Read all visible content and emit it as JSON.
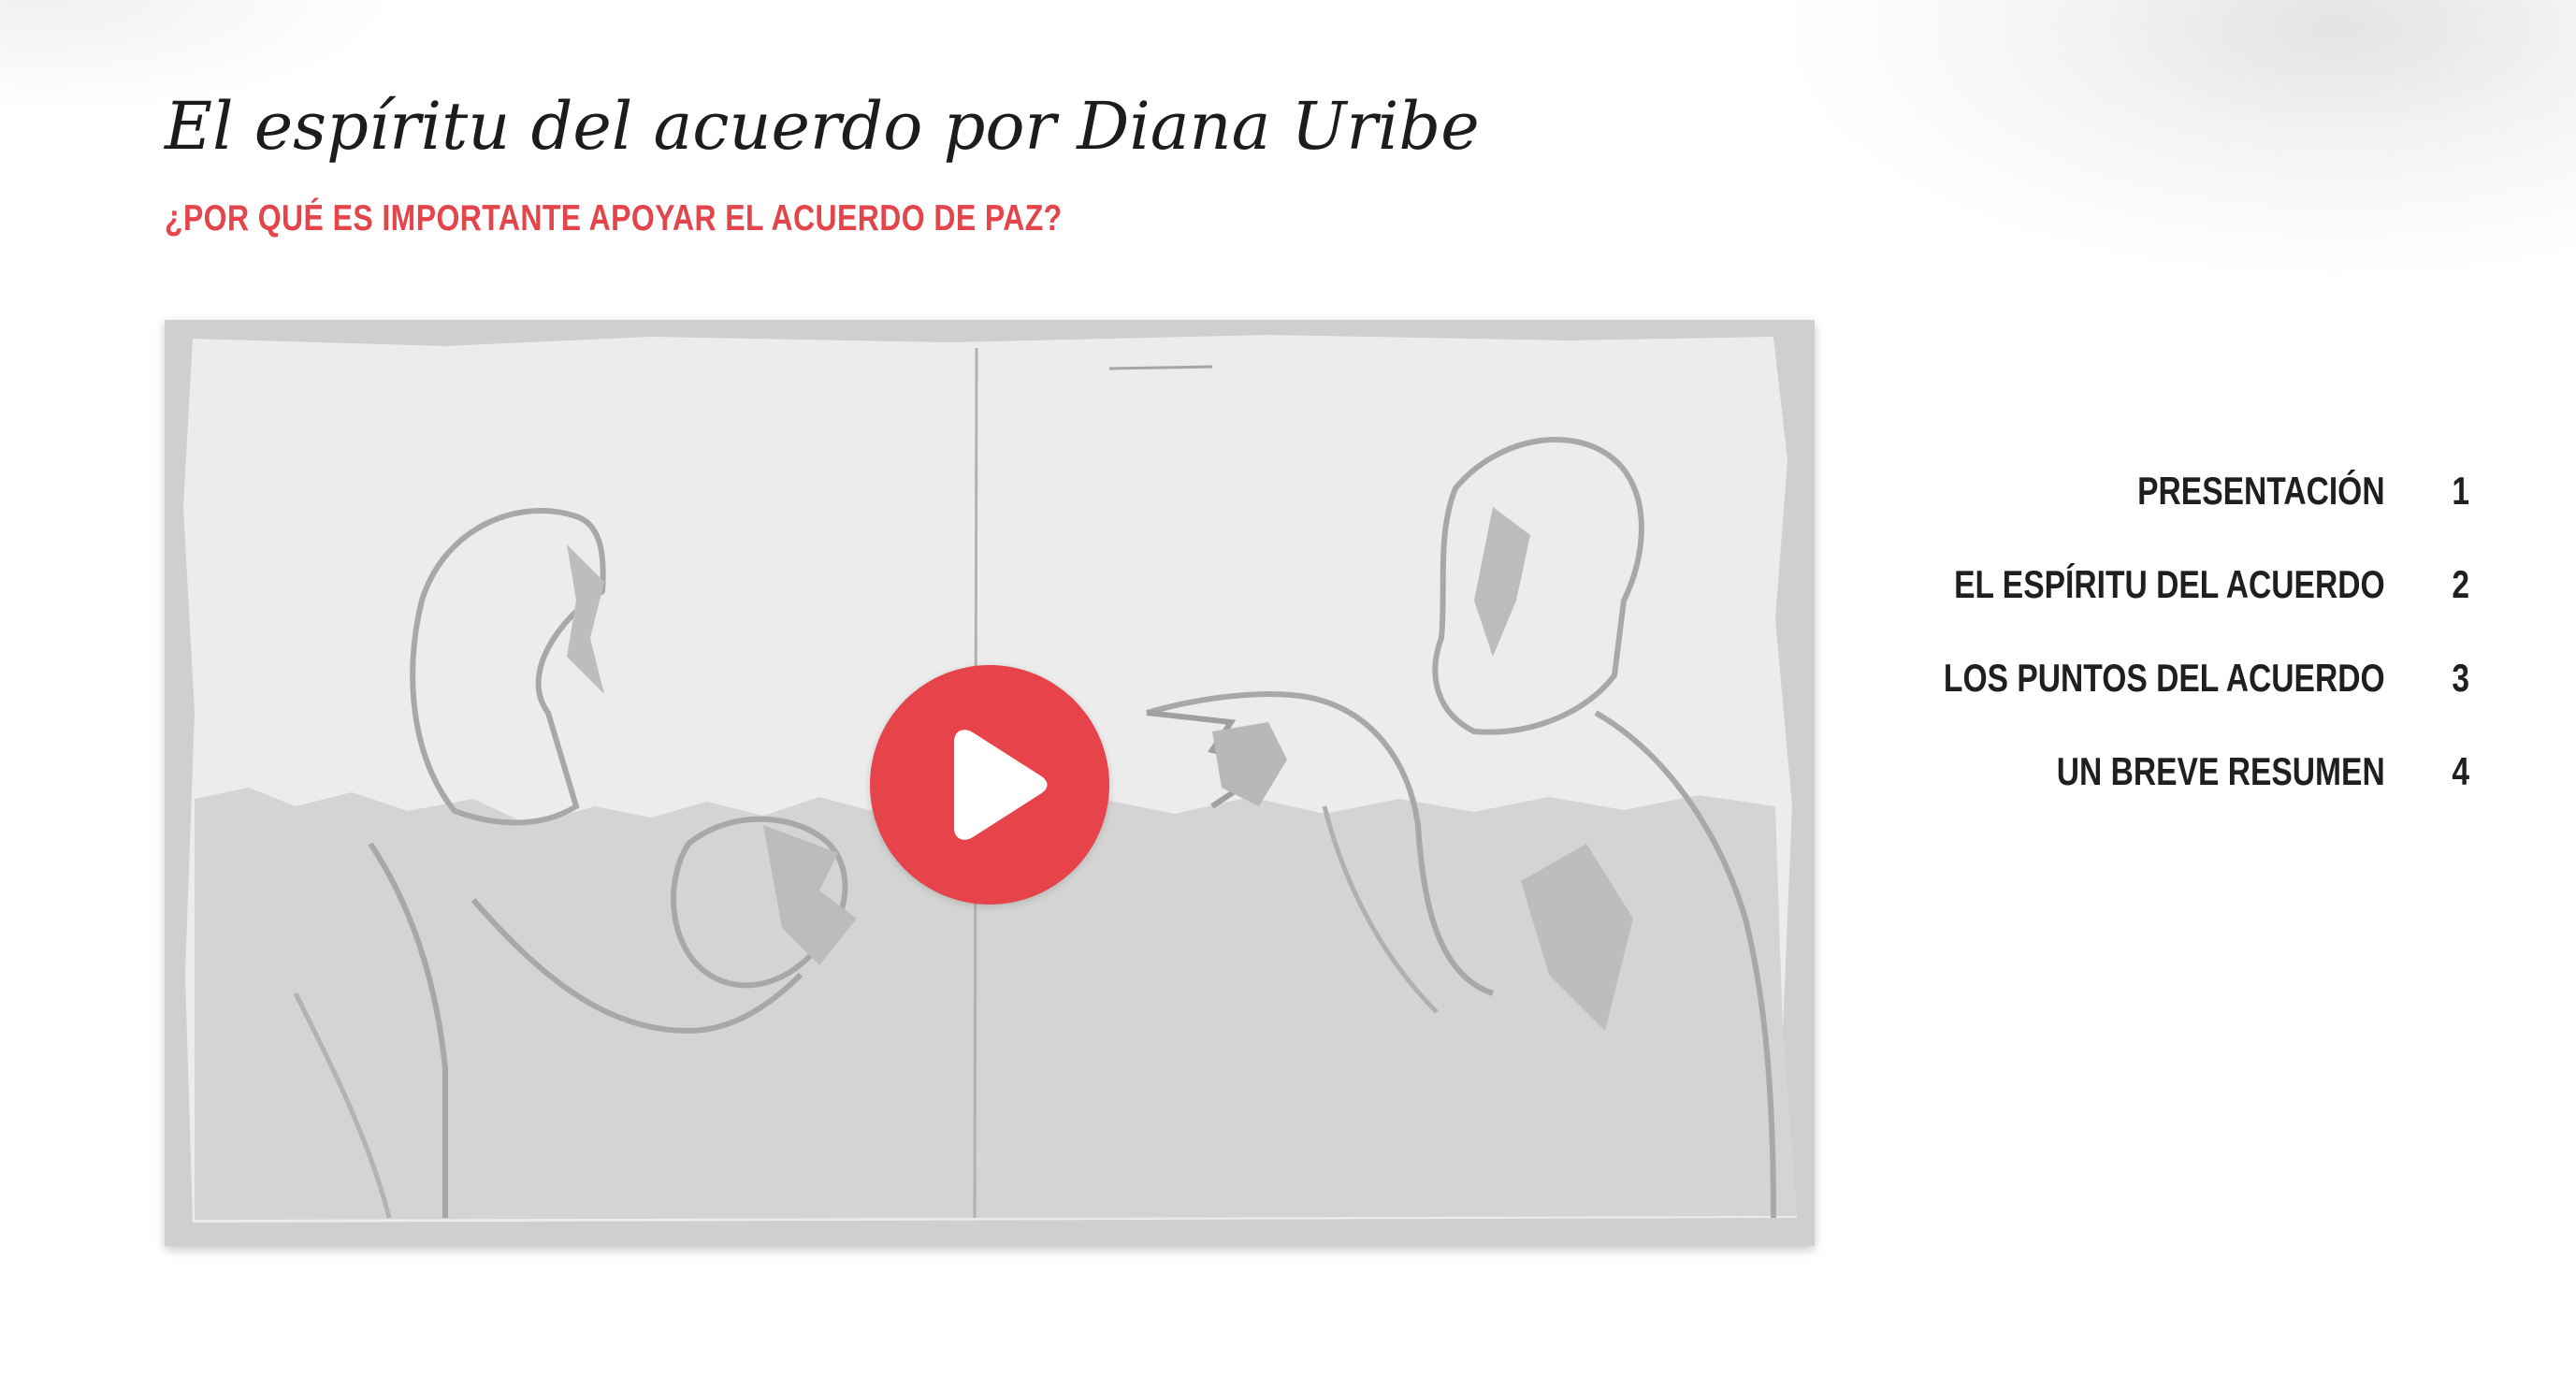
{
  "header": {
    "title": "El espíritu del acuerdo por Diana Uribe",
    "subtitle": "¿POR QUÉ ES IMPORTANTE APOYAR EL ACUERDO DE PAZ?"
  },
  "video": {
    "play_icon": "play-icon"
  },
  "chapters": [
    {
      "label": "PRESENTACIÓN",
      "number": "1"
    },
    {
      "label": "EL ESPÍRITU DEL ACUERDO",
      "number": "2"
    },
    {
      "label": "LOS PUNTOS DEL ACUERDO",
      "number": "3"
    },
    {
      "label": "UN BREVE RESUMEN",
      "number": "4"
    }
  ],
  "colors": {
    "accent": "#e4454a",
    "play_button": "#e6434b",
    "text": "#1f1f1f",
    "thumbnail_grey": "#d2d2d2"
  }
}
